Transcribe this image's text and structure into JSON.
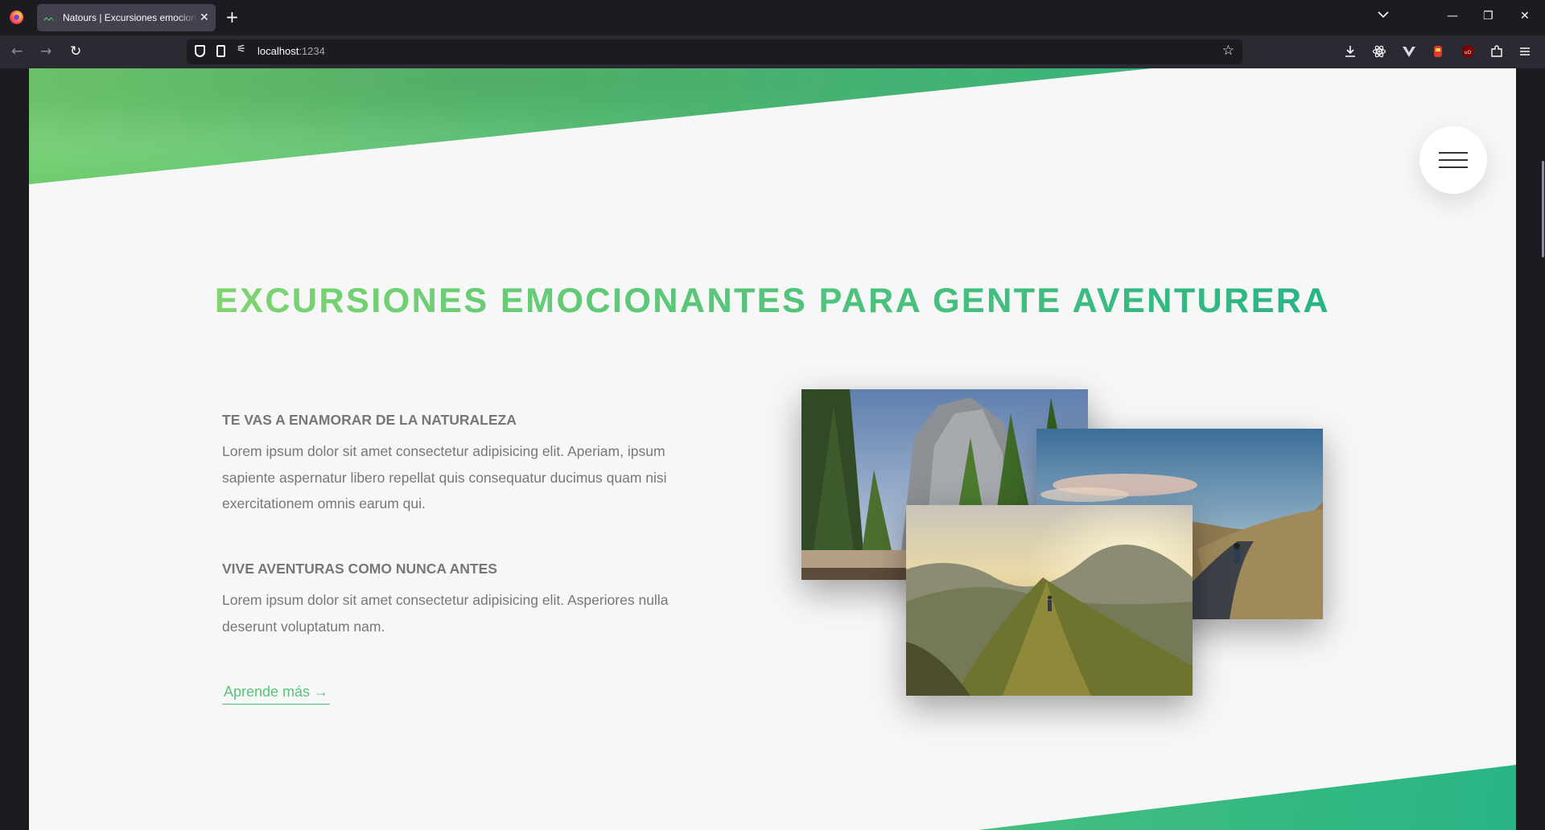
{
  "browser": {
    "tab_title": "Natours | Excursiones emocionantes para gente aventurera",
    "tab_close": "✕",
    "new_tab": "+",
    "url_host": "localhost",
    "url_port": ":1234",
    "tablist_icon": "chevron-down-icon",
    "window_minimize": "—",
    "window_restore": "❐",
    "window_close": "✕"
  },
  "page": {
    "section_title": "EXCURSIONES EMOCIONANTES PARA GENTE AVENTURERA",
    "features": [
      {
        "heading": "TE VAS A ENAMORAR DE LA NATURALEZA",
        "text": "Lorem ipsum dolor sit amet consectetur adipisicing elit. Aperiam, ipsum sapiente aspernatur libero repellat quis consequatur ducimus quam nisi exercitationem omnis earum qui."
      },
      {
        "heading": "VIVE AVENTURAS COMO NUNCA ANTES",
        "text": "Lorem ipsum dolor sit amet consectetur adipisicing elit. Asperiores nulla deserunt voluptatum nam."
      }
    ],
    "learn_more": "Aprende más →",
    "photos": [
      "forest-cliff-photo",
      "road-cyclist-photo",
      "mountain-ridge-hiker-photo"
    ],
    "colors": {
      "primary_light": "#7ed56f",
      "primary": "#55c57a",
      "primary_dark": "#28b485",
      "text": "#777777",
      "bg": "#f7f7f7"
    }
  }
}
